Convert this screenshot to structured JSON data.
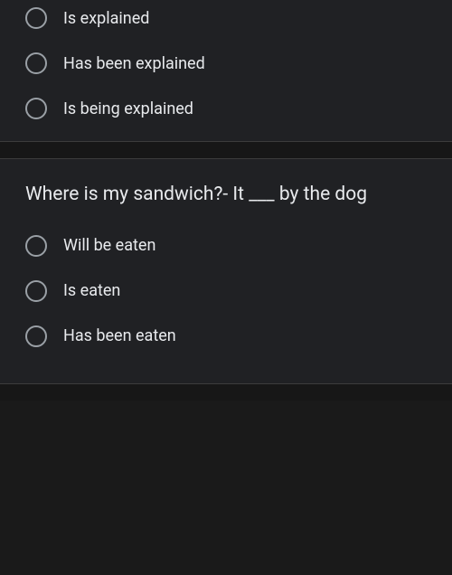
{
  "questions": [
    {
      "options": [
        {
          "label": "Is explained"
        },
        {
          "label": "Has been explained"
        },
        {
          "label": "Is being explained"
        }
      ]
    },
    {
      "prompt": "Where is my sandwich?- It ___ by the dog",
      "options": [
        {
          "label": "Will be eaten"
        },
        {
          "label": "Is eaten"
        },
        {
          "label": "Has been eaten"
        }
      ]
    }
  ]
}
